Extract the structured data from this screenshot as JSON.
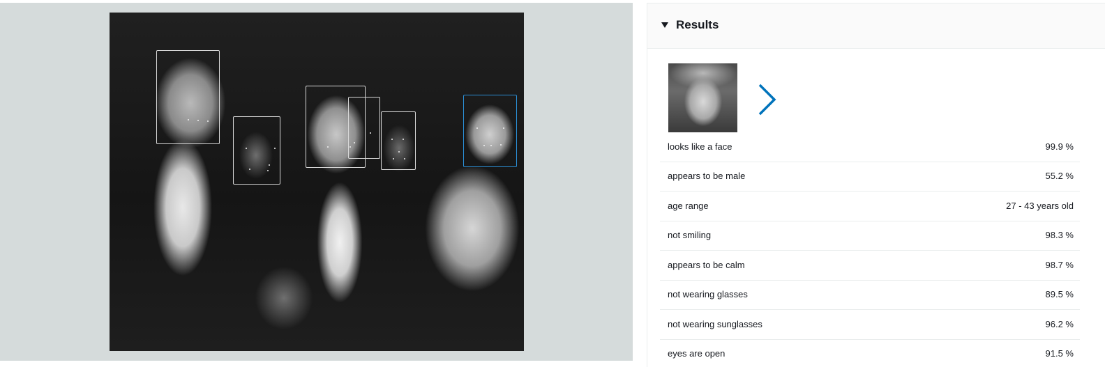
{
  "results": {
    "title": "Results",
    "rows": [
      {
        "label": "looks like a face",
        "value": "99.9 %"
      },
      {
        "label": "appears to be male",
        "value": "55.2 %"
      },
      {
        "label": "age range",
        "value": "27 - 43 years old"
      },
      {
        "label": "not smiling",
        "value": "98.3 %"
      },
      {
        "label": "appears to be calm",
        "value": "98.7 %"
      },
      {
        "label": "not wearing glasses",
        "value": "89.5 %"
      },
      {
        "label": "not wearing sunglasses",
        "value": "96.2 %"
      },
      {
        "label": "eyes are open",
        "value": "91.5 %"
      }
    ]
  },
  "icons": {
    "toggle": "caret-down-icon",
    "next": "chevron-right-icon"
  },
  "colors": {
    "selected_box": "#2b8fd6",
    "face_box": "#d9d9d9",
    "pane_background": "#d5dbdb",
    "accent": "#0073bb"
  }
}
